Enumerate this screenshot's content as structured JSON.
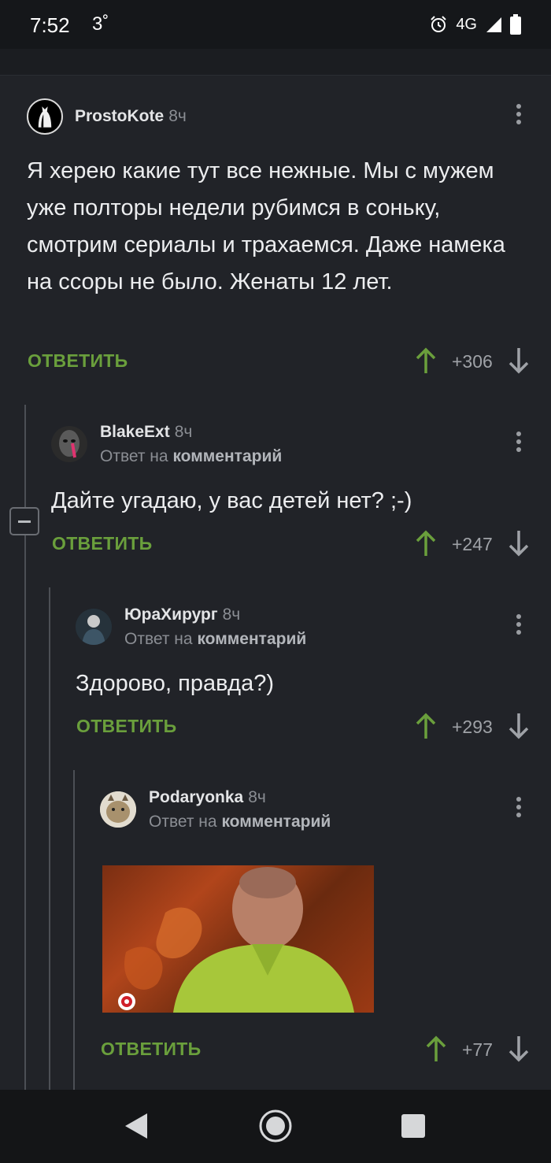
{
  "status_bar": {
    "time": "7:52",
    "temperature": "3˚",
    "network": "4G",
    "icons": [
      "alarm-icon",
      "signal-icon",
      "battery-icon"
    ]
  },
  "comments": [
    {
      "author": "ProstoKote",
      "time": "8ч",
      "text": "Я херею какие тут все нежные. Мы с мужем уже полторы недели рубимся в соньку, смотрим сериалы и трахаемся. Даже намека на ссоры не было. Женаты 12 лет.",
      "reply_label": "ОТВЕТИТЬ",
      "score": "+306"
    },
    {
      "author": "BlakeExt",
      "time": "8ч",
      "reply_prefix": "Ответ на",
      "reply_target": "комментарий",
      "text": "Дайте угадаю, у вас детей нет? ;-)",
      "reply_label": "ОТВЕТИТЬ",
      "score": "+247"
    },
    {
      "author": "ЮраХирург",
      "time": "8ч",
      "reply_prefix": "Ответ на",
      "reply_target": "комментарий",
      "text": "Здорово, правда?)",
      "reply_label": "ОТВЕТИТЬ",
      "score": "+293"
    },
    {
      "author": "Podaryonka",
      "time": "8ч",
      "reply_prefix": "Ответ на",
      "reply_target": "комментарий",
      "media": "gif-image",
      "reply_label": "ОТВЕТИТЬ",
      "score": "+77"
    }
  ],
  "nav_bar": {
    "icons": [
      "back-icon",
      "home-icon",
      "recents-icon"
    ]
  },
  "colors": {
    "background": "#212328",
    "accent_green": "#6a9f3c",
    "muted_text": "#8b8e94"
  }
}
